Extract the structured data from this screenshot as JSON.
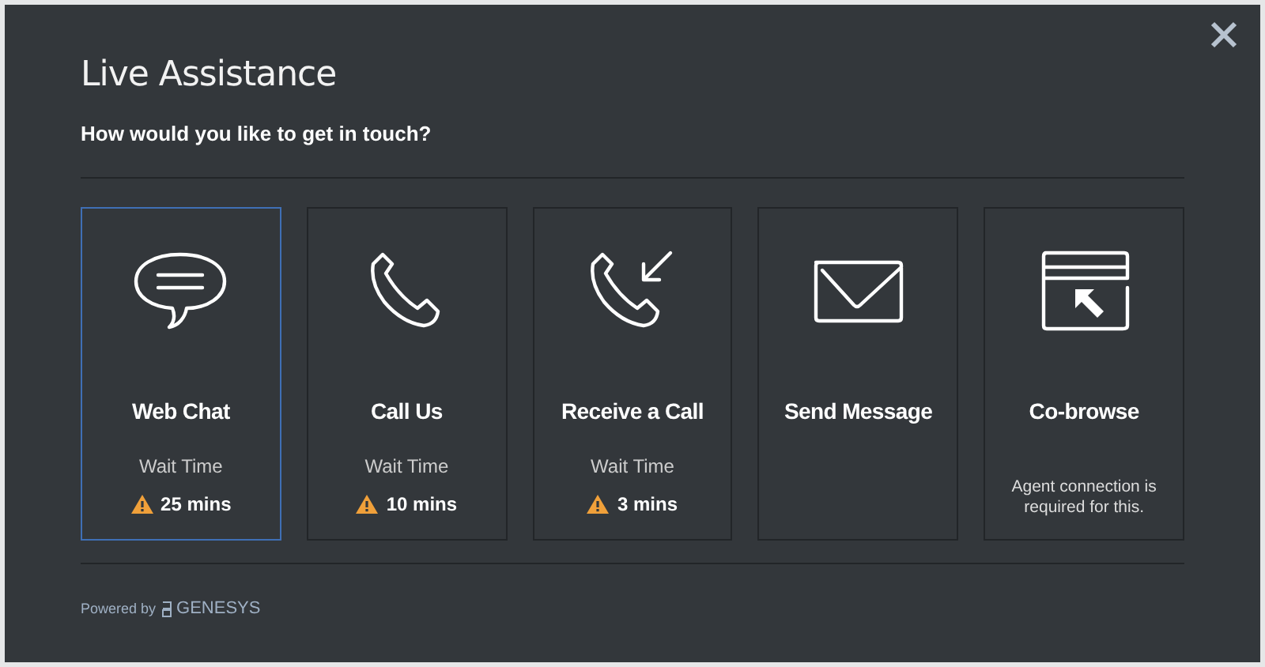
{
  "title": "Live Assistance",
  "subtitle": "How would you like to get in touch?",
  "options": [
    {
      "label": "Web Chat",
      "selected": true,
      "kind": "wait",
      "wait_label": "Wait Time",
      "wait_time": "25 mins"
    },
    {
      "label": "Call Us",
      "selected": false,
      "kind": "wait",
      "wait_label": "Wait Time",
      "wait_time": "10 mins"
    },
    {
      "label": "Receive a Call",
      "selected": false,
      "kind": "wait",
      "wait_label": "Wait Time",
      "wait_time": "3 mins"
    },
    {
      "label": "Send Message",
      "selected": false,
      "kind": "plain"
    },
    {
      "label": "Co-browse",
      "selected": false,
      "kind": "note",
      "note": "Agent connection is required for this."
    }
  ],
  "footer": {
    "powered_by": "Powered by",
    "brand": "GENESYS"
  }
}
